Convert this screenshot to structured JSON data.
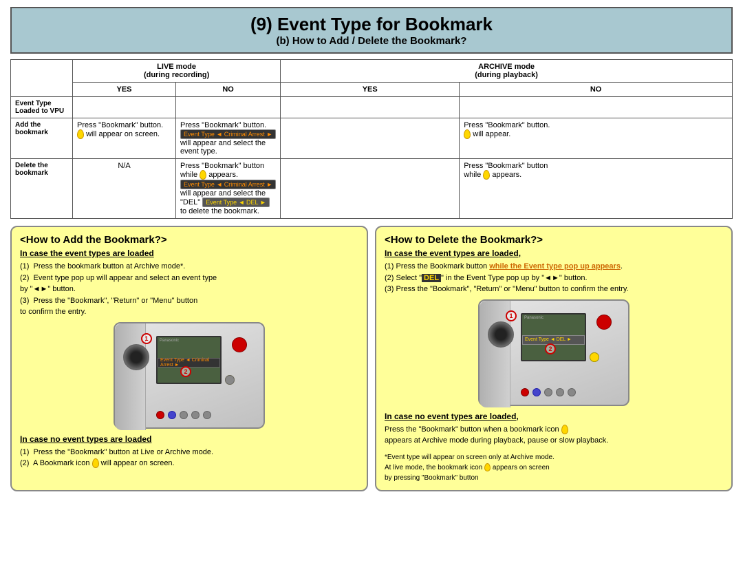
{
  "page": {
    "title_main": "(9) Event Type for Bookmark",
    "title_sub": "(b) How to Add / Delete the Bookmark?"
  },
  "table": {
    "headers": {
      "live_mode": "LIVE mode",
      "live_mode_sub": "(during recording)",
      "archive_mode": "ARCHIVE mode",
      "archive_mode_sub": "(during playback)"
    },
    "sub_headers": {
      "yes": "YES",
      "no": "NO",
      "archive_yes": "YES",
      "archive_no": "NO"
    },
    "row_label_col": "Event Type\nLoaded to VPU",
    "rows": [
      {
        "label": "Add the\nbookmark",
        "live_yes": "Press \"Bookmark\" button.\n🔖 will appear on screen.",
        "live_no": "Press \"Bookmark\" button. [Event Type◄ Criminal Arrest►]\nwill appear and select the event type.",
        "archive_yes": "",
        "archive_no": "Press \"Bookmark\" button.\n🔖 will appear."
      },
      {
        "label": "Delete the\nbookmark",
        "live_yes": "N/A",
        "live_no": "Press \"Bookmark\" button while 🔖 appears.\n[Event Type◄ Criminal Arrest►] will appear and select the\n\"DEL\" [Event Type◄ DEL►] to delete the bookmark.",
        "archive_yes": "",
        "archive_no": "Press \"Bookmark\" button\nwhile 🔖 appears."
      }
    ]
  },
  "add_panel": {
    "title": "<How to Add the Bookmark?>",
    "loaded_title": "In case the event types are loaded",
    "loaded_steps": [
      "(1)  Press the bookmark button at Archive mode*.",
      "(2)  Event type pop up will appear and select an event type",
      "by \"◄►\" button.",
      "(3)  Press the \"Bookmark\", \"Return\" or \"Menu\" button",
      "to confirm the entry."
    ],
    "no_loaded_title": "In case no event types are loaded",
    "no_loaded_steps": [
      "(1)  Press the \"Bookmark\" button at Live or Archive mode.",
      "(2)  A Bookmark icon 🔖 will appear on screen."
    ]
  },
  "delete_panel": {
    "title": "<How to Delete the Bookmark?>",
    "loaded_title": "In case the event types are loaded,",
    "loaded_steps": [
      "(1) Press the Bookmark button while the Event type pop up appears.",
      "(2) Select \"DEL\" in the Event Type pop up by  \"◄►\" button.",
      "(3) Press the \"Bookmark\", \"Return\" or \"Menu\" button to confirm the entry."
    ],
    "no_loaded_title": "In case no event types are loaded,",
    "no_loaded_text": "Press the \"Bookmark\" button when a bookmark icon 🔖\nappears at Archive mode during playback, pause or slow playback.",
    "note": "*Event type will appear on screen only at Archive mode.\nAt live mode, the bookmark icon 🔖 appears on screen\nby pressing \"Bookmark\" button"
  }
}
